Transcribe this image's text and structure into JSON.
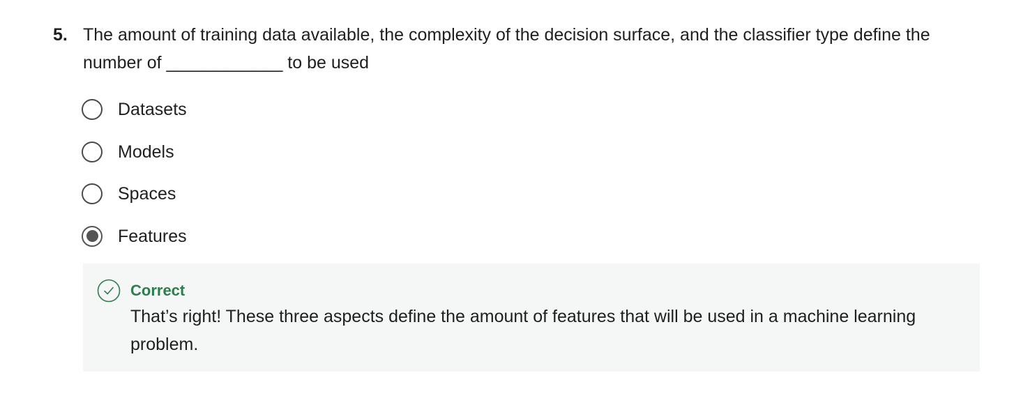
{
  "question": {
    "number": "5.",
    "text": "The amount of training data available, the complexity of the decision surface, and the classifier type define the number of ____________ to be used"
  },
  "options": [
    {
      "label": "Datasets",
      "selected": false
    },
    {
      "label": "Models",
      "selected": false
    },
    {
      "label": "Spaces",
      "selected": false
    },
    {
      "label": "Features",
      "selected": true
    }
  ],
  "feedback": {
    "icon": "check-circle-icon",
    "status": "Correct",
    "status_color": "#2f7d4e",
    "text": "That’s right! These three aspects define the amount of features that will be used in a machine learning problem."
  }
}
